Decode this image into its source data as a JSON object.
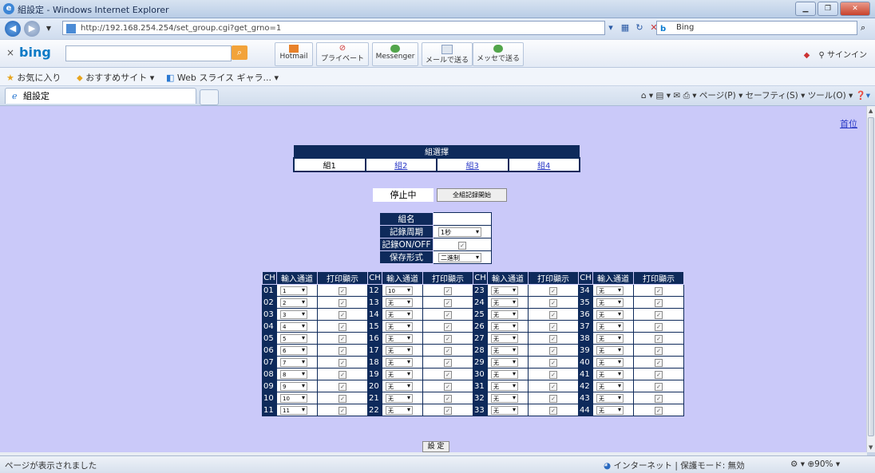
{
  "browser": {
    "window_title": "組設定 - Windows Internet Explorer",
    "url": "http://192.168.254.254/set_group.cgi?get_grno=1",
    "search_engine": "Bing",
    "bing_toolbar": {
      "logo": "bing",
      "buttons": [
        "Hotmail",
        "プライベート",
        "Messenger",
        "メールで送る",
        "メッセで送る"
      ],
      "signin": "サインイン"
    },
    "favorites": {
      "favorites_label": "お気に入り",
      "recommended_sites": "おすすめサイト ▾",
      "web_slice": "Web スライス ギャラ... ▾"
    },
    "tab_title": "組設定",
    "command_bar": "ページ(P) ▾   セーフティ(S) ▾   ツール(O) ▾",
    "status_message": "ページが表示されました",
    "zone": "インターネット | 保護モード: 無効",
    "zoom": "90%"
  },
  "page": {
    "top_link": "首位",
    "group_select": {
      "header": "組選擇",
      "groups": [
        "組1",
        "組2",
        "組3",
        "組4"
      ],
      "selected_index": 0
    },
    "status": "停止中",
    "start_all_button": "全組記録開始",
    "settings": {
      "name_label": "組名",
      "name_value": "",
      "interval_label": "記錄周期",
      "interval_value": "1秒",
      "record_label": "記錄ON/OFF",
      "record_checked": true,
      "format_label": "保存形式",
      "format_value": "二進制"
    },
    "channel_table": {
      "headers": [
        "CH",
        "輸入通道",
        "打印顯示"
      ],
      "columns": [
        {
          "rows": [
            {
              "ch": "01",
              "input": "1",
              "print": true
            },
            {
              "ch": "02",
              "input": "2",
              "print": true
            },
            {
              "ch": "03",
              "input": "3",
              "print": true
            },
            {
              "ch": "04",
              "input": "4",
              "print": true
            },
            {
              "ch": "05",
              "input": "5",
              "print": true
            },
            {
              "ch": "06",
              "input": "6",
              "print": true
            },
            {
              "ch": "07",
              "input": "7",
              "print": true
            },
            {
              "ch": "08",
              "input": "8",
              "print": true
            },
            {
              "ch": "09",
              "input": "9",
              "print": true
            },
            {
              "ch": "10",
              "input": "10",
              "print": true
            },
            {
              "ch": "11",
              "input": "11",
              "print": true
            }
          ]
        },
        {
          "rows": [
            {
              "ch": "12",
              "input": "10",
              "print": true
            },
            {
              "ch": "13",
              "input": "无",
              "print": true
            },
            {
              "ch": "14",
              "input": "无",
              "print": true
            },
            {
              "ch": "15",
              "input": "无",
              "print": true
            },
            {
              "ch": "16",
              "input": "无",
              "print": true
            },
            {
              "ch": "17",
              "input": "无",
              "print": true
            },
            {
              "ch": "18",
              "input": "无",
              "print": true
            },
            {
              "ch": "19",
              "input": "无",
              "print": true
            },
            {
              "ch": "20",
              "input": "无",
              "print": true
            },
            {
              "ch": "21",
              "input": "无",
              "print": true
            },
            {
              "ch": "22",
              "input": "无",
              "print": true
            }
          ]
        },
        {
          "rows": [
            {
              "ch": "23",
              "input": "无",
              "print": true
            },
            {
              "ch": "24",
              "input": "无",
              "print": true
            },
            {
              "ch": "25",
              "input": "无",
              "print": true
            },
            {
              "ch": "26",
              "input": "无",
              "print": true
            },
            {
              "ch": "27",
              "input": "无",
              "print": true
            },
            {
              "ch": "28",
              "input": "无",
              "print": true
            },
            {
              "ch": "29",
              "input": "无",
              "print": true
            },
            {
              "ch": "30",
              "input": "无",
              "print": true
            },
            {
              "ch": "31",
              "input": "无",
              "print": true
            },
            {
              "ch": "32",
              "input": "无",
              "print": true
            },
            {
              "ch": "33",
              "input": "无",
              "print": true
            }
          ]
        },
        {
          "rows": [
            {
              "ch": "34",
              "input": "无",
              "print": true
            },
            {
              "ch": "35",
              "input": "无",
              "print": true
            },
            {
              "ch": "36",
              "input": "无",
              "print": true
            },
            {
              "ch": "37",
              "input": "无",
              "print": true
            },
            {
              "ch": "38",
              "input": "无",
              "print": true
            },
            {
              "ch": "39",
              "input": "无",
              "print": true
            },
            {
              "ch": "40",
              "input": "无",
              "print": true
            },
            {
              "ch": "41",
              "input": "无",
              "print": true
            },
            {
              "ch": "42",
              "input": "无",
              "print": true
            },
            {
              "ch": "43",
              "input": "无",
              "print": true
            },
            {
              "ch": "44",
              "input": "无",
              "print": true
            }
          ]
        }
      ]
    },
    "submit_button": "設 定"
  },
  "colors": {
    "page_background": "#cac9f9",
    "header_navy": "#0e2a5b",
    "link_blue": "#2a39c6"
  }
}
